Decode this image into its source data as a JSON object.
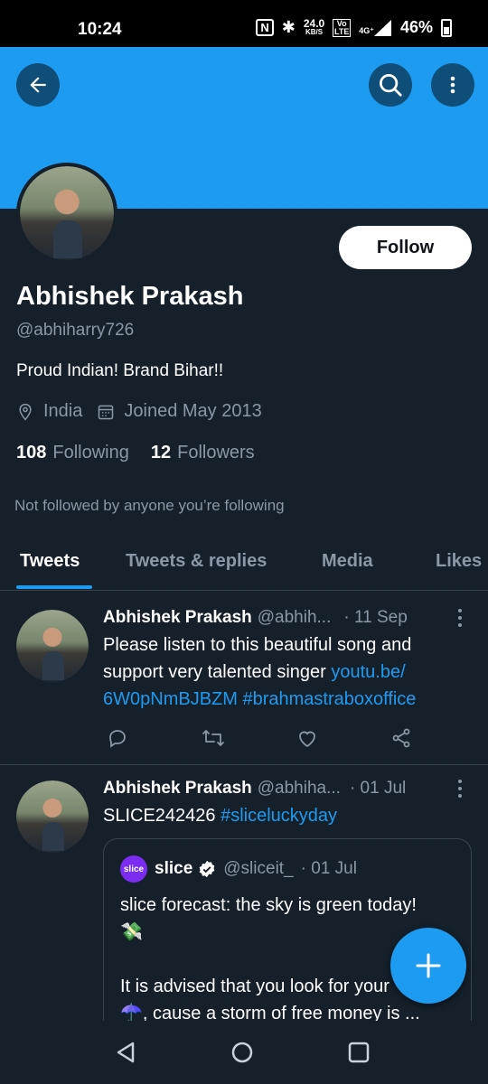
{
  "status_bar": {
    "time": "10:24",
    "nfc": "N",
    "bluetooth": "✱",
    "speed_value": "24.0",
    "speed_unit": "KB/S",
    "volte": "Vo LTE",
    "network": "4G⁺",
    "battery": "46%"
  },
  "header": {
    "back_icon": "arrow-left-icon",
    "search_icon": "search-icon",
    "more_icon": "more-vertical-icon",
    "banner_color": "#1d9bf0"
  },
  "profile": {
    "name": "Abhishek Prakash",
    "handle": "@abhiharry726",
    "bio": "Proud Indian! Brand Bihar!!",
    "location": "India",
    "joined": "Joined May 2013",
    "following_count": "108",
    "following_label": "Following",
    "followers_count": "12",
    "followers_label": "Followers",
    "not_followed_text": "Not followed by anyone you’re following",
    "follow_button": "Follow"
  },
  "tabs": [
    {
      "label": "Tweets",
      "active": true
    },
    {
      "label": "Tweets & replies",
      "active": false
    },
    {
      "label": "Media",
      "active": false
    },
    {
      "label": "Likes",
      "active": false
    }
  ],
  "tweets": [
    {
      "name": "Abhishek Prakash",
      "handle": "@abhih...",
      "time": "· 11 Sep",
      "text_plain": "Please listen to this beautiful song and support very talented singer ",
      "link1": "youtu.be/ 6W0pNmBJBZM",
      "hashtag": "#brahmastraboxoffice"
    },
    {
      "name": "Abhishek Prakash",
      "handle": "@abhiha...",
      "time": "· 01 Jul",
      "text_plain": "SLICE242426 ",
      "hashtag": "#sliceluckyday",
      "quote": {
        "logo_text": "slice",
        "name": "slice",
        "handle": "@sliceit_",
        "time": "· 01 Jul",
        "line1": "slice forecast: the sky is green today!",
        "emoji1": "💸",
        "line2": "It is advised that you look for your",
        "line3": "☂️, cause a storm of free money is ..."
      }
    }
  ],
  "fab": {
    "icon": "plus-icon",
    "color": "#1d9bf0"
  },
  "nav": {
    "back": "nav-back-icon",
    "home": "nav-home-icon",
    "recents": "nav-recents-icon"
  }
}
